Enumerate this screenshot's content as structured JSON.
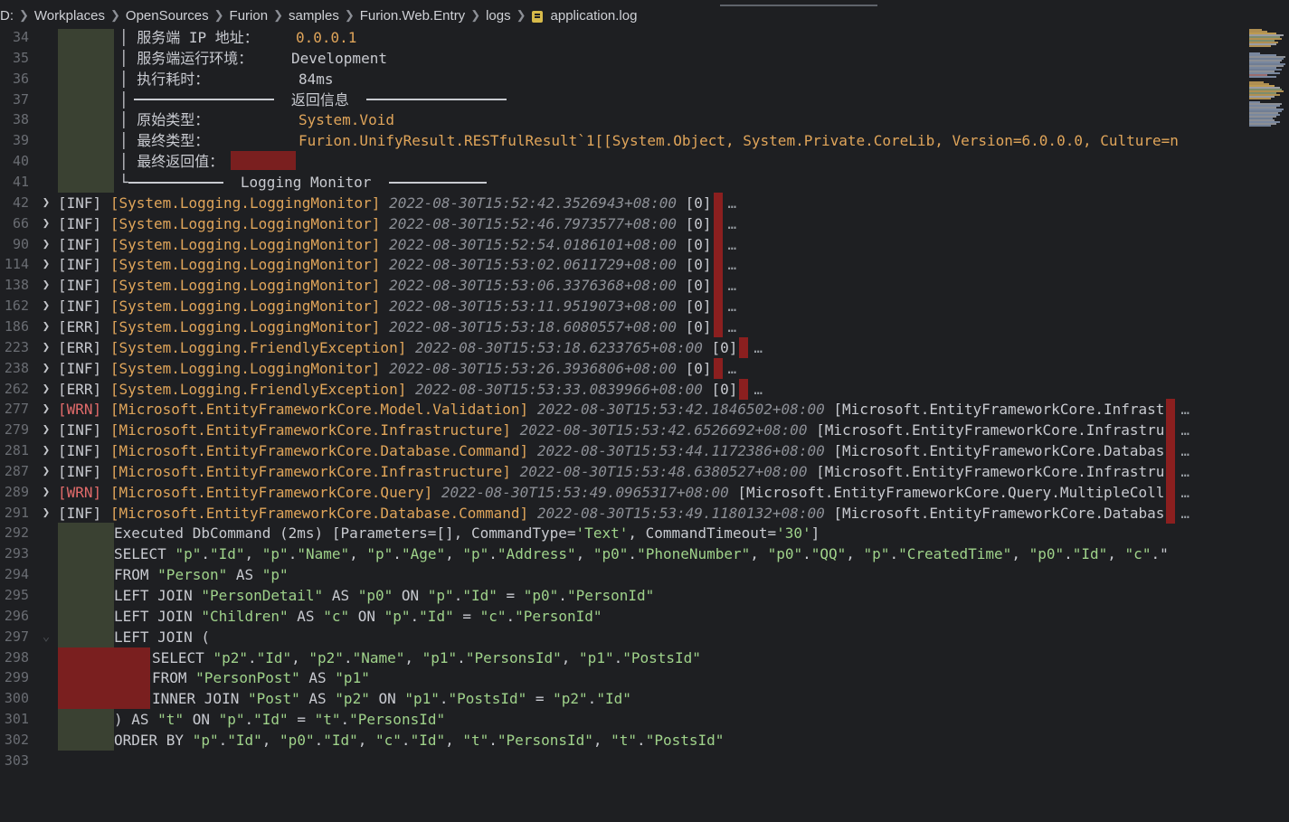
{
  "breadcrumb": [
    "D:",
    "Workplaces",
    "OpenSources",
    "Furion",
    "samples",
    "Furion.Web.Entry",
    "logs",
    "application.log"
  ],
  "icons": {
    "separator": "chevron-right-icon",
    "file": "log-file-icon",
    "expand": "chevron-right-icon",
    "collapse": "chevron-down-icon"
  },
  "colors": {
    "background": "#1e1f22",
    "indent_guide": "#3a4132",
    "redaction": "#7a1f1f",
    "string": "#9fd28a",
    "category": "#e0a55a",
    "warn": "#e26b6b"
  },
  "header_block": {
    "lines": [
      {
        "num": "34",
        "label": "服务端 IP 地址：",
        "value": "0.0.0.1"
      },
      {
        "num": "35",
        "label": "服务端运行环境：",
        "value": "Development"
      },
      {
        "num": "36",
        "label": "执行耗时：",
        "value": "84ms"
      },
      {
        "num": "37",
        "section": "返回信息"
      },
      {
        "num": "38",
        "label": "原始类型：",
        "value": "System.Void"
      },
      {
        "num": "39",
        "label": "最终类型：",
        "value_parts": [
          "Furion.UnifyResult.RESTfulResult`1[[System.Object, System.Private.CoreLib, Version=",
          "6.0.0.0",
          ", Culture=n"
        ]
      },
      {
        "num": "40",
        "label": "最终返回值："
      },
      {
        "num": "41",
        "footer": "Logging Monitor"
      }
    ]
  },
  "log_entries": [
    {
      "num": "42",
      "level": "[INF]",
      "category": "[System.Logging.LoggingMonitor]",
      "timestamp": "2022-08-30T15:52:42.3526943+08:00",
      "tail": "[0]"
    },
    {
      "num": "66",
      "level": "[INF]",
      "category": "[System.Logging.LoggingMonitor]",
      "timestamp": "2022-08-30T15:52:46.7973577+08:00",
      "tail": "[0]"
    },
    {
      "num": "90",
      "level": "[INF]",
      "category": "[System.Logging.LoggingMonitor]",
      "timestamp": "2022-08-30T15:52:54.0186101+08:00",
      "tail": "[0]"
    },
    {
      "num": "114",
      "level": "[INF]",
      "category": "[System.Logging.LoggingMonitor]",
      "timestamp": "2022-08-30T15:53:02.0611729+08:00",
      "tail": "[0]"
    },
    {
      "num": "138",
      "level": "[INF]",
      "category": "[System.Logging.LoggingMonitor]",
      "timestamp": "2022-08-30T15:53:06.3376368+08:00",
      "tail": "[0]"
    },
    {
      "num": "162",
      "level": "[INF]",
      "category": "[System.Logging.LoggingMonitor]",
      "timestamp": "2022-08-30T15:53:11.9519073+08:00",
      "tail": "[0]"
    },
    {
      "num": "186",
      "level": "[ERR]",
      "category": "[System.Logging.LoggingMonitor]",
      "timestamp": "2022-08-30T15:53:18.6080557+08:00",
      "tail": "[0]"
    },
    {
      "num": "223",
      "level": "[ERR]",
      "category": "[System.Logging.FriendlyException]",
      "timestamp": "2022-08-30T15:53:18.6233765+08:00",
      "tail": "[0]"
    },
    {
      "num": "238",
      "level": "[INF]",
      "category": "[System.Logging.LoggingMonitor]",
      "timestamp": "2022-08-30T15:53:26.3936806+08:00",
      "tail": "[0]"
    },
    {
      "num": "262",
      "level": "[ERR]",
      "category": "[System.Logging.FriendlyException]",
      "timestamp": "2022-08-30T15:53:33.0839966+08:00",
      "tail": "[0]"
    },
    {
      "num": "277",
      "level": "[WRN]",
      "category": "[Microsoft.EntityFrameworkCore.Model.Validation]",
      "timestamp": "2022-08-30T15:53:42.1846502+08:00",
      "tail": "[Microsoft.EntityFrameworkCore.Infrast"
    },
    {
      "num": "279",
      "level": "[INF]",
      "category": "[Microsoft.EntityFrameworkCore.Infrastructure]",
      "timestamp": "2022-08-30T15:53:42.6526692+08:00",
      "tail": "[Microsoft.EntityFrameworkCore.Infrastru"
    },
    {
      "num": "281",
      "level": "[INF]",
      "category": "[Microsoft.EntityFrameworkCore.Database.Command]",
      "timestamp": "2022-08-30T15:53:44.1172386+08:00",
      "tail": "[Microsoft.EntityFrameworkCore.Databas"
    },
    {
      "num": "287",
      "level": "[INF]",
      "category": "[Microsoft.EntityFrameworkCore.Infrastructure]",
      "timestamp": "2022-08-30T15:53:48.6380527+08:00",
      "tail": "[Microsoft.EntityFrameworkCore.Infrastru"
    },
    {
      "num": "289",
      "level": "[WRN]",
      "category": "[Microsoft.EntityFrameworkCore.Query]",
      "timestamp": "2022-08-30T15:53:49.0965317+08:00",
      "tail": "[Microsoft.EntityFrameworkCore.Query.MultipleColl"
    },
    {
      "num": "291",
      "level": "[INF]",
      "category": "[Microsoft.EntityFrameworkCore.Database.Command]",
      "timestamp": "2022-08-30T15:53:49.1180132+08:00",
      "tail": "[Microsoft.EntityFrameworkCore.Databas"
    }
  ],
  "sql_block": [
    {
      "num": "292",
      "text": "Executed DbCommand (2ms) [Parameters=[], CommandType='Text', CommandTimeout='30']"
    },
    {
      "num": "293",
      "text": "SELECT \"p\".\"Id\", \"p\".\"Name\", \"p\".\"Age\", \"p\".\"Address\", \"p0\".\"PhoneNumber\", \"p0\".\"QQ\", \"p\".\"CreatedTime\", \"p0\".\"Id\", \"c\".\""
    },
    {
      "num": "294",
      "text": "FROM \"Person\" AS \"p\""
    },
    {
      "num": "295",
      "text": "LEFT JOIN \"PersonDetail\" AS \"p0\" ON \"p\".\"Id\" = \"p0\".\"PersonId\""
    },
    {
      "num": "296",
      "text": "LEFT JOIN \"Children\" AS \"c\" ON \"p\".\"Id\" = \"c\".\"PersonId\""
    },
    {
      "num": "297",
      "text": "LEFT JOIN ("
    },
    {
      "num": "298",
      "text": "SELECT \"p2\".\"Id\", \"p2\".\"Name\", \"p1\".\"PersonsId\", \"p1\".\"PostsId\""
    },
    {
      "num": "299",
      "text": "FROM \"PersonPost\" AS \"p1\""
    },
    {
      "num": "300",
      "text": "INNER JOIN \"Post\" AS \"p2\" ON \"p1\".\"PostsId\" = \"p2\".\"Id\""
    },
    {
      "num": "301",
      "text": ") AS \"t\" ON \"p\".\"Id\" = \"t\".\"PersonsId\""
    },
    {
      "num": "302",
      "text": "ORDER BY \"p\".\"Id\", \"p0\".\"Id\", \"c\".\"Id\", \"t\".\"PersonsId\", \"t\".\"PostsId\""
    },
    {
      "num": "303",
      "text": ""
    }
  ]
}
